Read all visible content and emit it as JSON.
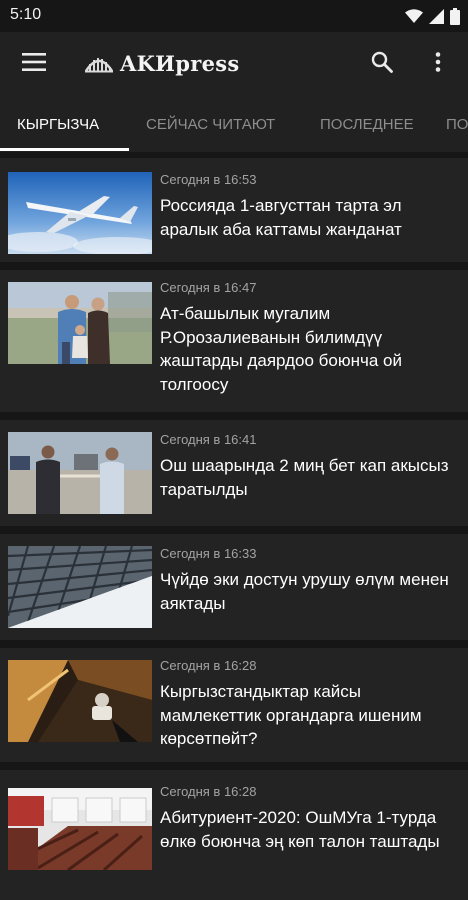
{
  "status": {
    "time": "5:10"
  },
  "app": {
    "brand": "AKИpress"
  },
  "tabs": [
    {
      "label": "КЫРГЫЗЧА"
    },
    {
      "label": "СЕЙЧАС ЧИТАЮТ"
    },
    {
      "label": "ПОСЛЕДНЕЕ"
    },
    {
      "label": "ПО"
    }
  ],
  "articles": [
    {
      "time": "Сегодня в 16:53",
      "title": "Россияда 1-августтан тарта эл аралык аба каттамы жанданат"
    },
    {
      "time": "Сегодня в 16:47",
      "title": "Ат-башылык мугалим Р.Орозалиеванын билимдүү жаштарды даярдоо боюнча ой толгоосу"
    },
    {
      "time": "Сегодня в 16:41",
      "title": "Ош шаарында 2 миң бет кап акысыз таратылды"
    },
    {
      "time": "Сегодня в 16:33",
      "title": "Чүйдө эки достун урушу өлүм менен аяктады"
    },
    {
      "time": "Сегодня в 16:28",
      "title": "Кыргызстандыктар кайсы мамлекеттик органдарга ишеним көрсөтпөйт?"
    },
    {
      "time": "Сегодня в 16:28",
      "title": "Абитуриент-2020: ОшМУга 1-турда өлкө боюнча эң көп талон таштады"
    }
  ]
}
